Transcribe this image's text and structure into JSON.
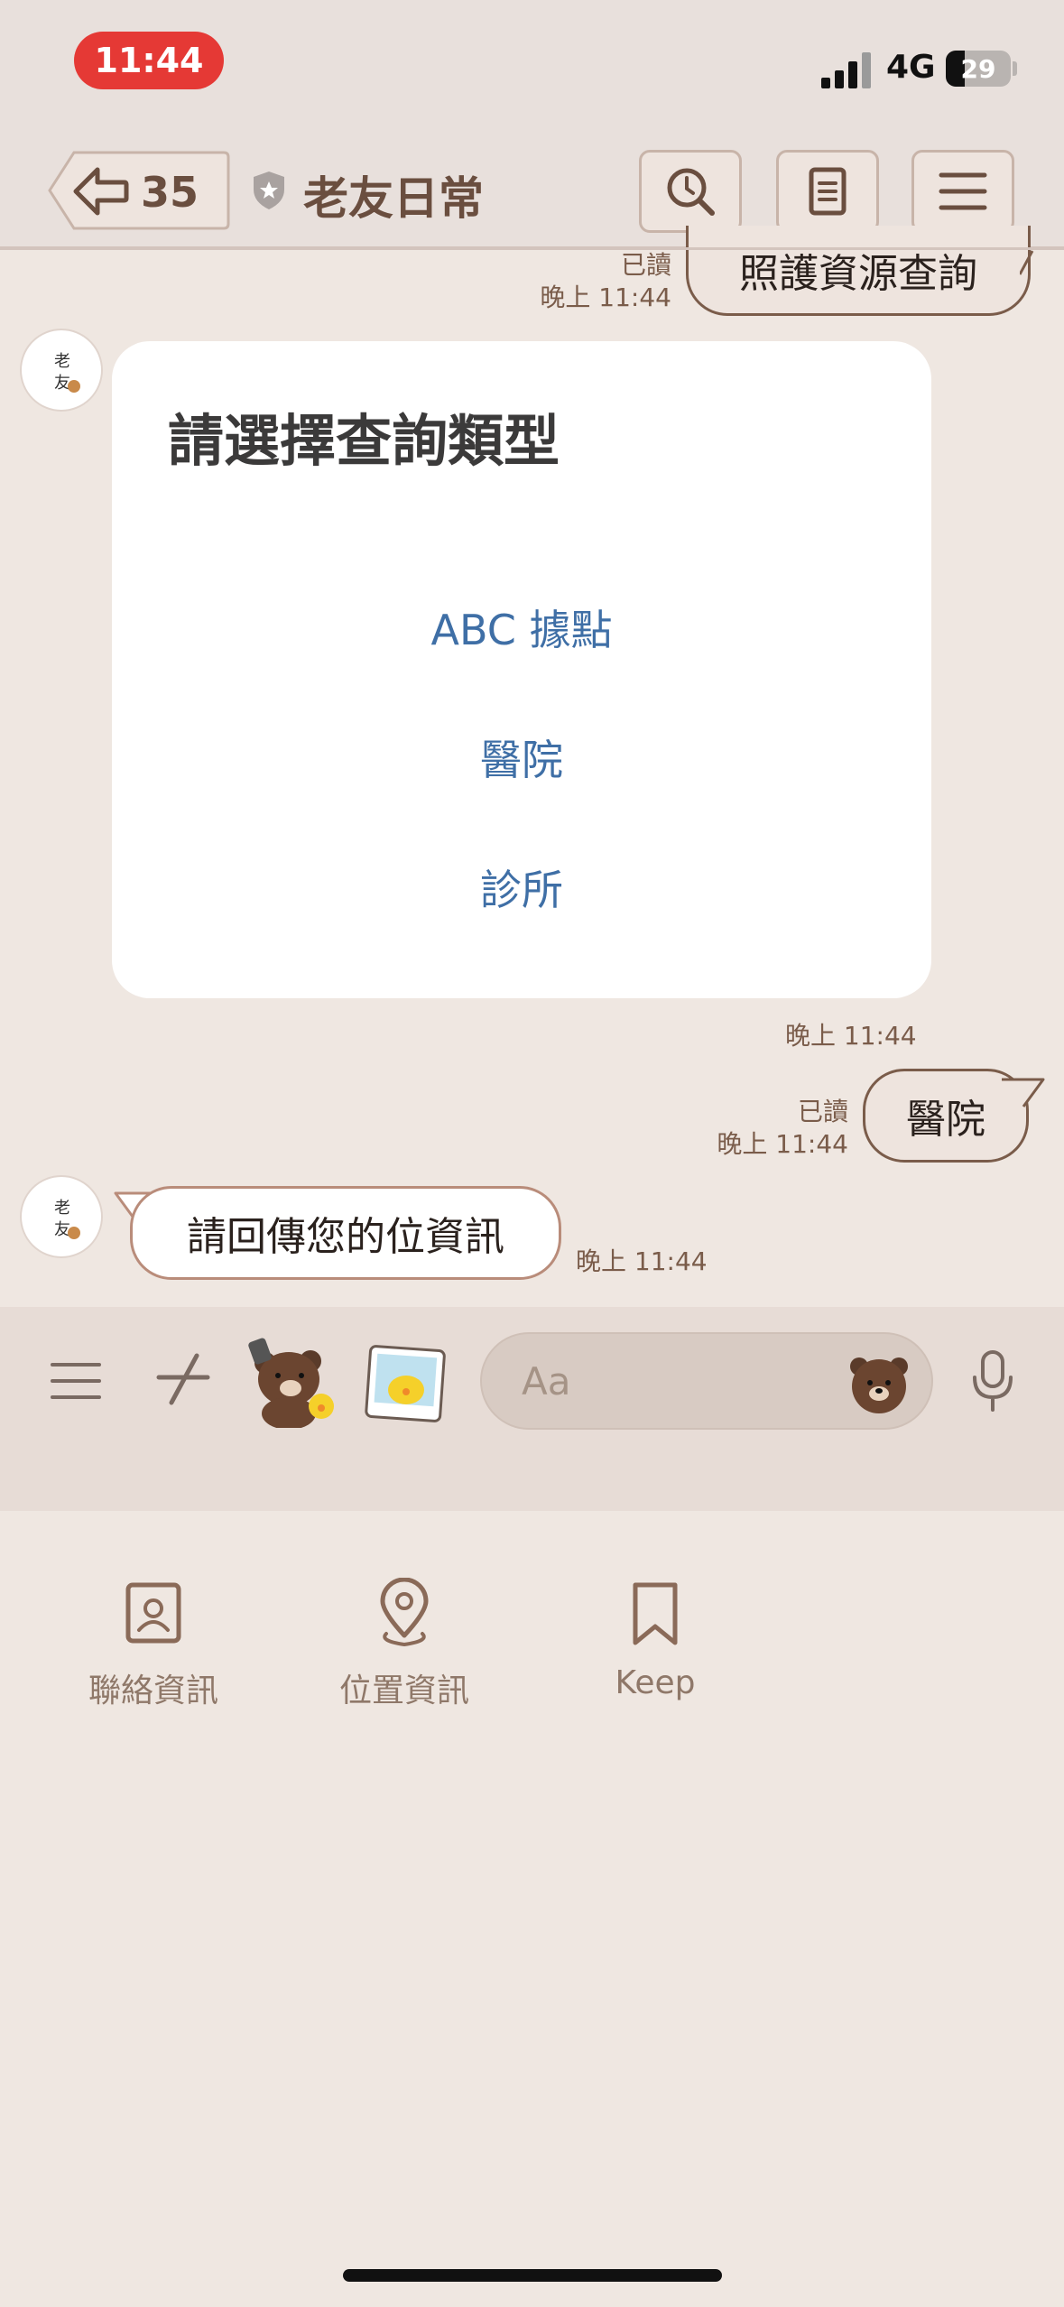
{
  "status_bar": {
    "time": "11:44",
    "network": "4G",
    "battery": "29"
  },
  "header": {
    "back_count": "35",
    "title": "老友日常"
  },
  "messages": {
    "m1": {
      "read": "已讀",
      "time": "晚上 11:44",
      "text": "照護資源查詢"
    },
    "card": {
      "title": "請選擇查詢類型",
      "options": [
        "ABC 據點",
        "醫院",
        "診所"
      ],
      "time": "晚上 11:44"
    },
    "m2": {
      "read": "已讀",
      "time": "晚上 11:44",
      "text": "醫院"
    },
    "m3": {
      "text": "請回傳您的位資訊",
      "time": "晚上 11:44"
    }
  },
  "input": {
    "placeholder": "Aa"
  },
  "attach_menu": {
    "items": [
      "聯絡資訊",
      "位置資訊",
      "Keep"
    ]
  },
  "colors": {
    "accent": "#7a5c4a",
    "link": "#3f6fa6",
    "time_pill": "#e53935"
  }
}
